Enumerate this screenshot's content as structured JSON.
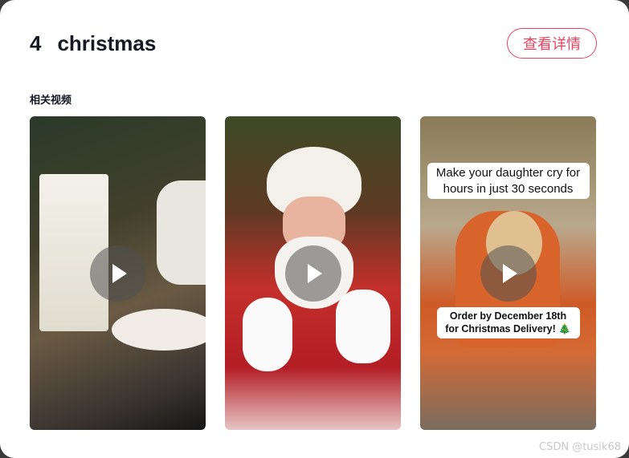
{
  "header": {
    "rank": "4",
    "keyword": "christmas",
    "detail_button": "查看详情"
  },
  "section": {
    "label": "相关视频"
  },
  "videos": [
    {
      "captions": []
    },
    {
      "captions": []
    },
    {
      "captions": [
        "Make your daughter cry for hours in just 30 seconds",
        "Order by December 18th for Christmas Delivery! 🎄"
      ]
    }
  ],
  "watermark": "CSDN @tusik68",
  "colors": {
    "accent": "#e8435f",
    "title": "#161823"
  }
}
